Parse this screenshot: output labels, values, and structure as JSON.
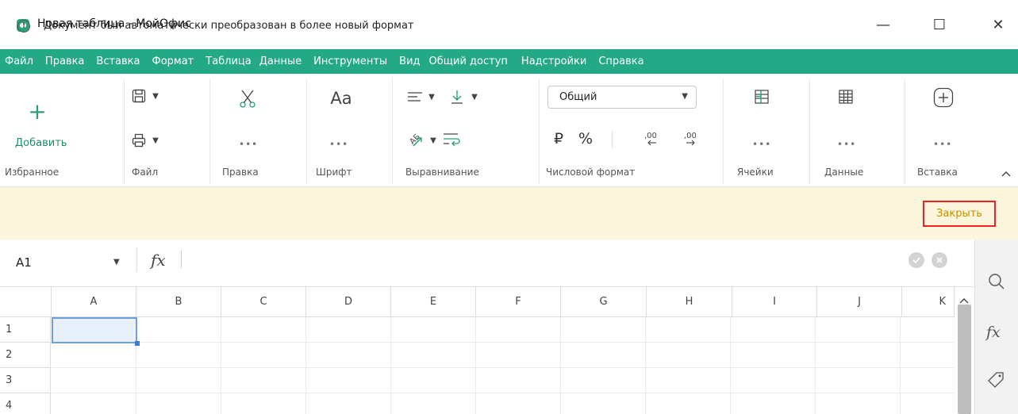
{
  "window": {
    "title": "Новая таблица - МойОфис",
    "minimize": "—",
    "maximize": "☐",
    "close": "✕"
  },
  "menu": [
    "Файл",
    "Правка",
    "Вставка",
    "Формат",
    "Таблица",
    "Данные",
    "Инструменты",
    "Вид",
    "Общий доступ",
    "Надстройки",
    "Справка"
  ],
  "ribbon": {
    "favorites": {
      "add_label": "Добавить",
      "group": "Избранное"
    },
    "file": {
      "group": "Файл"
    },
    "edit": {
      "group": "Правка",
      "more": "•••"
    },
    "font": {
      "group": "Шрифт",
      "glyph": "Aa",
      "more": "•••"
    },
    "align": {
      "group": "Выравнивание"
    },
    "numfmt": {
      "group": "Числовой формат",
      "select_value": "Общий",
      "currency": "₽",
      "percent": "%"
    },
    "cells": {
      "group": "Ячейки",
      "more": "•••"
    },
    "data": {
      "group": "Данные",
      "more": "•••"
    },
    "insert": {
      "group": "Вставка",
      "more": "•••"
    }
  },
  "notification": {
    "text": "Документ был автоматически преобразован в более новый формат",
    "close_label": "Закрыть"
  },
  "formula_bar": {
    "cell_ref": "A1",
    "fx": "fx"
  },
  "grid": {
    "columns": [
      "A",
      "B",
      "C",
      "D",
      "E",
      "F",
      "G",
      "H",
      "I",
      "J",
      "K"
    ],
    "rows": [
      "1",
      "2",
      "3",
      "4"
    ]
  },
  "colors": {
    "accent": "#24a987",
    "notification_bg": "#fbf6dc",
    "close_link": "#c89000"
  }
}
